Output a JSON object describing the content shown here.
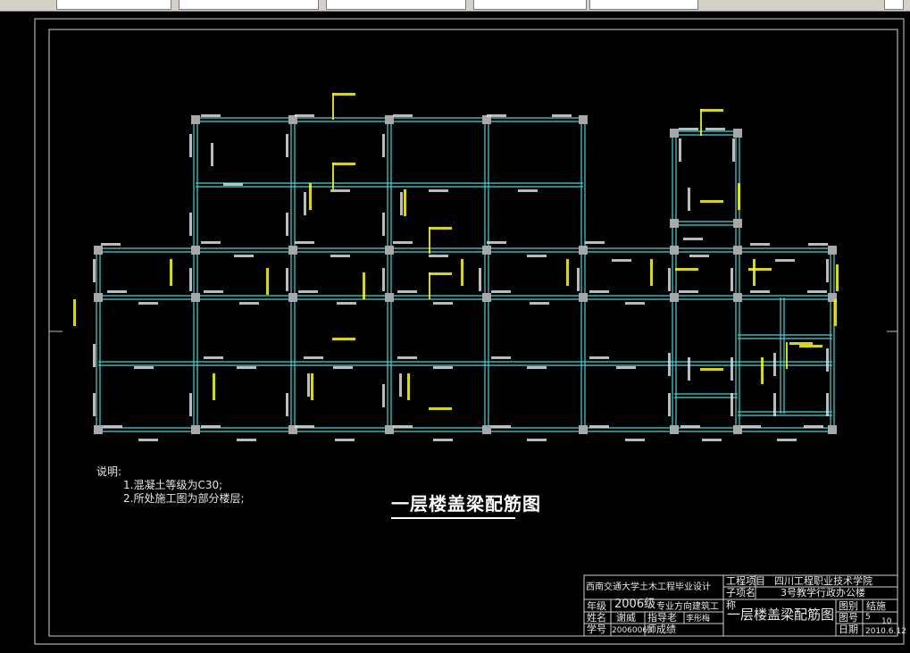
{
  "toolbar": {
    "fields": [
      "",
      "",
      "",
      "",
      "",
      ""
    ]
  },
  "drawing": {
    "title": "一层楼盖梁配筋图",
    "notes": {
      "heading": "说明:",
      "items": [
        "1.混凝土等级为C30;",
        "2.所处施工图为部分楼层;"
      ]
    }
  },
  "title_block": {
    "school": "西南交通大学土木工程毕业设计",
    "project_label": "工程项目",
    "project_value": "四川工程职业技术学院",
    "subitem_label": "子项名",
    "subitem_value": "3号教学行政办公楼",
    "name_label": "称",
    "grade_label": "年级",
    "grade_value": "2006级",
    "major_value": "专业方向建筑工",
    "student_label": "姓名",
    "student_name": "谢威",
    "advisor_label": "指导老",
    "advisor_name": "李彤梅",
    "id_label": "学号",
    "student_id": "20060063",
    "teacher_label": "师成绩",
    "drawing_name": "一层楼盖梁配筋图",
    "category_label": "图别",
    "category_value": "结施",
    "number_label": "图号",
    "number_value": "5",
    "total_value": "10",
    "date_label": "日期",
    "date_value": "2010.6.12"
  },
  "colors": {
    "background": "#000000",
    "beam": "#3fd6d6",
    "column": "#a8a8a8",
    "annotation": "#ffff00",
    "text": "#e8e8e8"
  }
}
